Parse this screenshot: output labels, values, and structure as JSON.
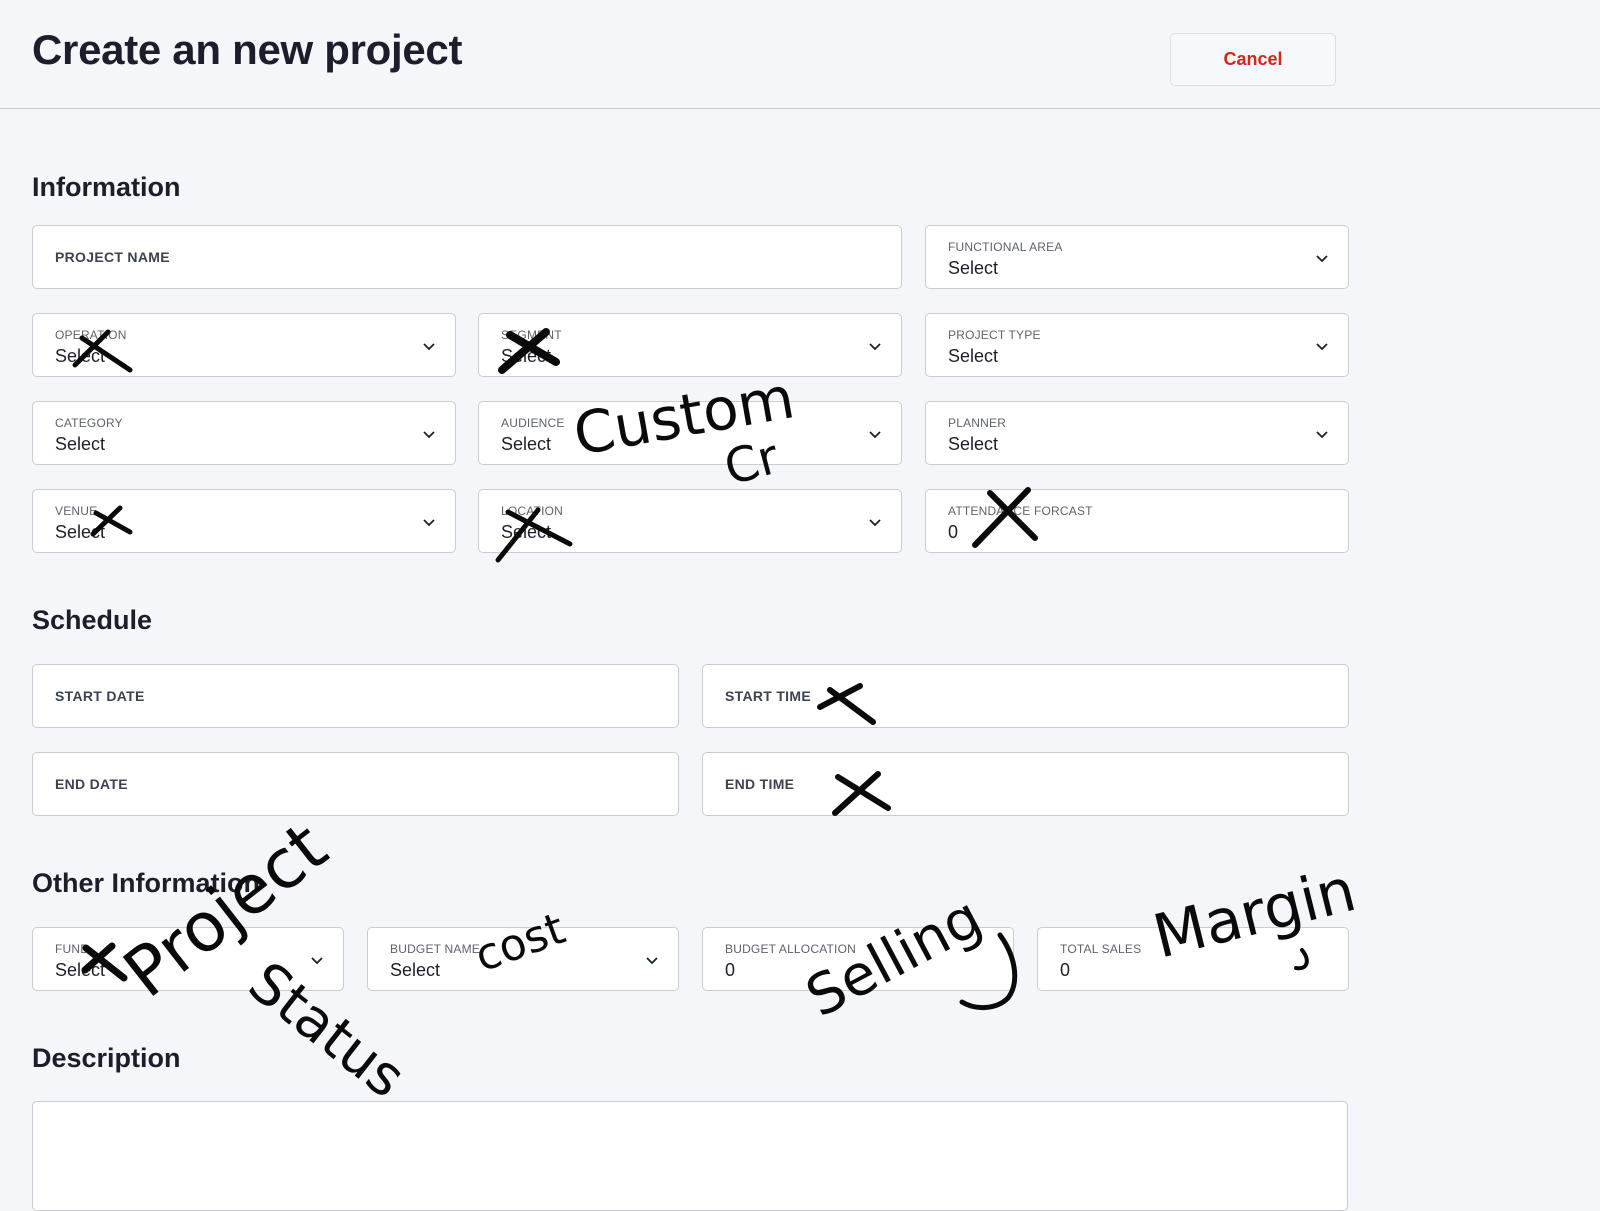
{
  "header": {
    "title": "Create an new project",
    "cancel_label": "Cancel"
  },
  "sections": {
    "information": "Information",
    "schedule": "Schedule",
    "other": "Other Information",
    "description": "Description"
  },
  "fields": {
    "project_name": {
      "label": "PROJECT NAME"
    },
    "functional_area": {
      "label": "FUNCTIONAL AREA",
      "value": "Select"
    },
    "operation": {
      "label": "OPERATION",
      "value": "Select"
    },
    "segment": {
      "label": "SEGMENT",
      "value": "Select"
    },
    "project_type": {
      "label": "PROJECT TYPE",
      "value": "Select"
    },
    "category": {
      "label": "CATEGORY",
      "value": "Select"
    },
    "audience": {
      "label": "AUDIENCE",
      "value": "Select"
    },
    "planner": {
      "label": "PLANNER",
      "value": "Select"
    },
    "venue": {
      "label": "VENUE",
      "value": "Select"
    },
    "location": {
      "label": "LOCATION",
      "value": "Select"
    },
    "attendance_forcast": {
      "label": "ATTENDANCE FORCAST",
      "value": "0"
    },
    "start_date": {
      "label": "START DATE"
    },
    "start_time": {
      "label": "START TIME"
    },
    "end_date": {
      "label": "END DATE"
    },
    "end_time": {
      "label": "END TIME"
    },
    "fund": {
      "label": "FUND",
      "value": "Select"
    },
    "budget_name": {
      "label": "BUDGET NAME",
      "value": "Select"
    },
    "budget_allocation": {
      "label": "BUDGET ALLOCATION",
      "value": "0"
    },
    "total_sales": {
      "label": "TOTAL SALES",
      "value": "0"
    }
  },
  "annotations": {
    "custom": "Custom",
    "cr": "Cr",
    "project": "Project",
    "status": "Status",
    "cost": "cost",
    "selling": "Selling",
    "margin": "Margin"
  },
  "icons": {
    "dropdown": "chevron-down-icon",
    "strike": "x-mark"
  },
  "colors": {
    "cancel": "#d0281b",
    "ink": "#0a0a0a",
    "background": "#f5f6fa",
    "border": "#c9ccd4"
  }
}
